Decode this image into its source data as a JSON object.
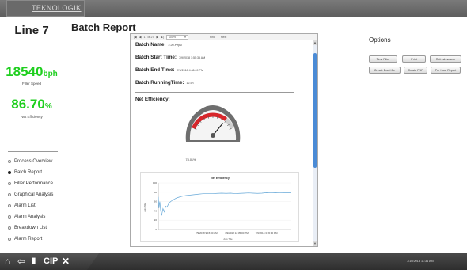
{
  "app": {
    "logo": "TEKNOLOGIK",
    "line_title": "Line 7",
    "page_title": "Batch Report"
  },
  "kpis": {
    "speed_value": "18540",
    "speed_unit": "bph",
    "speed_label": "Filler Speed",
    "eff_value": "86.70",
    "eff_unit": "%",
    "eff_label": "Net Efficiency"
  },
  "nav": [
    {
      "label": "Process Overview",
      "active": false
    },
    {
      "label": "Batch Report",
      "active": true
    },
    {
      "label": "Filler Performance",
      "active": false
    },
    {
      "label": "Graphical Analysis",
      "active": false
    },
    {
      "label": "Alarm List",
      "active": false
    },
    {
      "label": "Alarm Analysis",
      "active": false
    },
    {
      "label": "Breakdown List",
      "active": false
    },
    {
      "label": "Alarm Report",
      "active": false
    }
  ],
  "viewer": {
    "page_current": "1",
    "page_of": "of 27",
    "zoom": "100%",
    "find": "Find",
    "next": "Next",
    "batch_name_label": "Batch Name:",
    "batch_name_value": "2.20-Pepsi",
    "start_label": "Batch Start Time:",
    "start_value": "7/9/2018 1:55:35 AM",
    "end_label": "Batch End Time:",
    "end_value": "7/9/2018 4:46:09 PM",
    "running_label": "Batch RunningTime:",
    "running_value": "12.5h",
    "net_eff_label": "Net Efficiency:",
    "gauge_value": 78.01,
    "gauge_value_text": "78.01%"
  },
  "chart_data": {
    "type": "line",
    "title": "Net Efficiency",
    "xlabel": "Axis Title",
    "ylabel": "Axis Title",
    "ylim": [
      0,
      100
    ],
    "yticks": [
      0,
      20,
      40,
      60,
      80,
      100
    ],
    "xtick_labels": [
      "7/9/2018 9:15:00 AM",
      "7/9/2018 12:35:00 PM",
      "7/9/2018 3:55:00 PM"
    ],
    "xtick_positions_h": [
      7.3,
      10.67,
      14.0
    ],
    "xlim_h": [
      1.93,
      16.77
    ],
    "x_h": [
      1.93,
      2.0,
      2.1,
      2.2,
      2.3,
      2.45,
      2.6,
      2.75,
      2.9,
      3.1,
      3.3,
      3.6,
      4.0,
      4.5,
      5.0,
      5.5,
      6.0,
      6.5,
      7.0,
      7.5,
      8.0,
      8.5,
      9.0,
      9.5,
      10.0,
      10.5,
      11.0,
      11.5,
      12.0,
      12.5,
      13.0,
      13.5,
      14.0,
      14.5,
      15.0,
      15.5,
      16.0,
      16.5,
      16.77
    ],
    "y": [
      70,
      46,
      60,
      40,
      30,
      45,
      38,
      50,
      48,
      56,
      60,
      64,
      68,
      71,
      73,
      74,
      75,
      76,
      77,
      77,
      77,
      77.5,
      78,
      77.5,
      78,
      77,
      77.5,
      78,
      78.5,
      78,
      77.5,
      78,
      79,
      78.5,
      79,
      78.5,
      79,
      79,
      79
    ],
    "series": [
      {
        "name": "",
        "color": "#66a8d8"
      }
    ]
  },
  "options": {
    "title": "Options",
    "buttons": [
      "Time Filter",
      "Print",
      "Refresh search",
      "Create Excel file",
      "Create PDF",
      "Per Hour Report"
    ]
  },
  "bottom": {
    "cip": "CIP",
    "datetime": "7/10/2018   11:34 AM"
  },
  "colors": {
    "kpi_green": "#1fcf1f",
    "scroll_blue": "#4a8bd6",
    "gauge_red": "#d8262b"
  }
}
